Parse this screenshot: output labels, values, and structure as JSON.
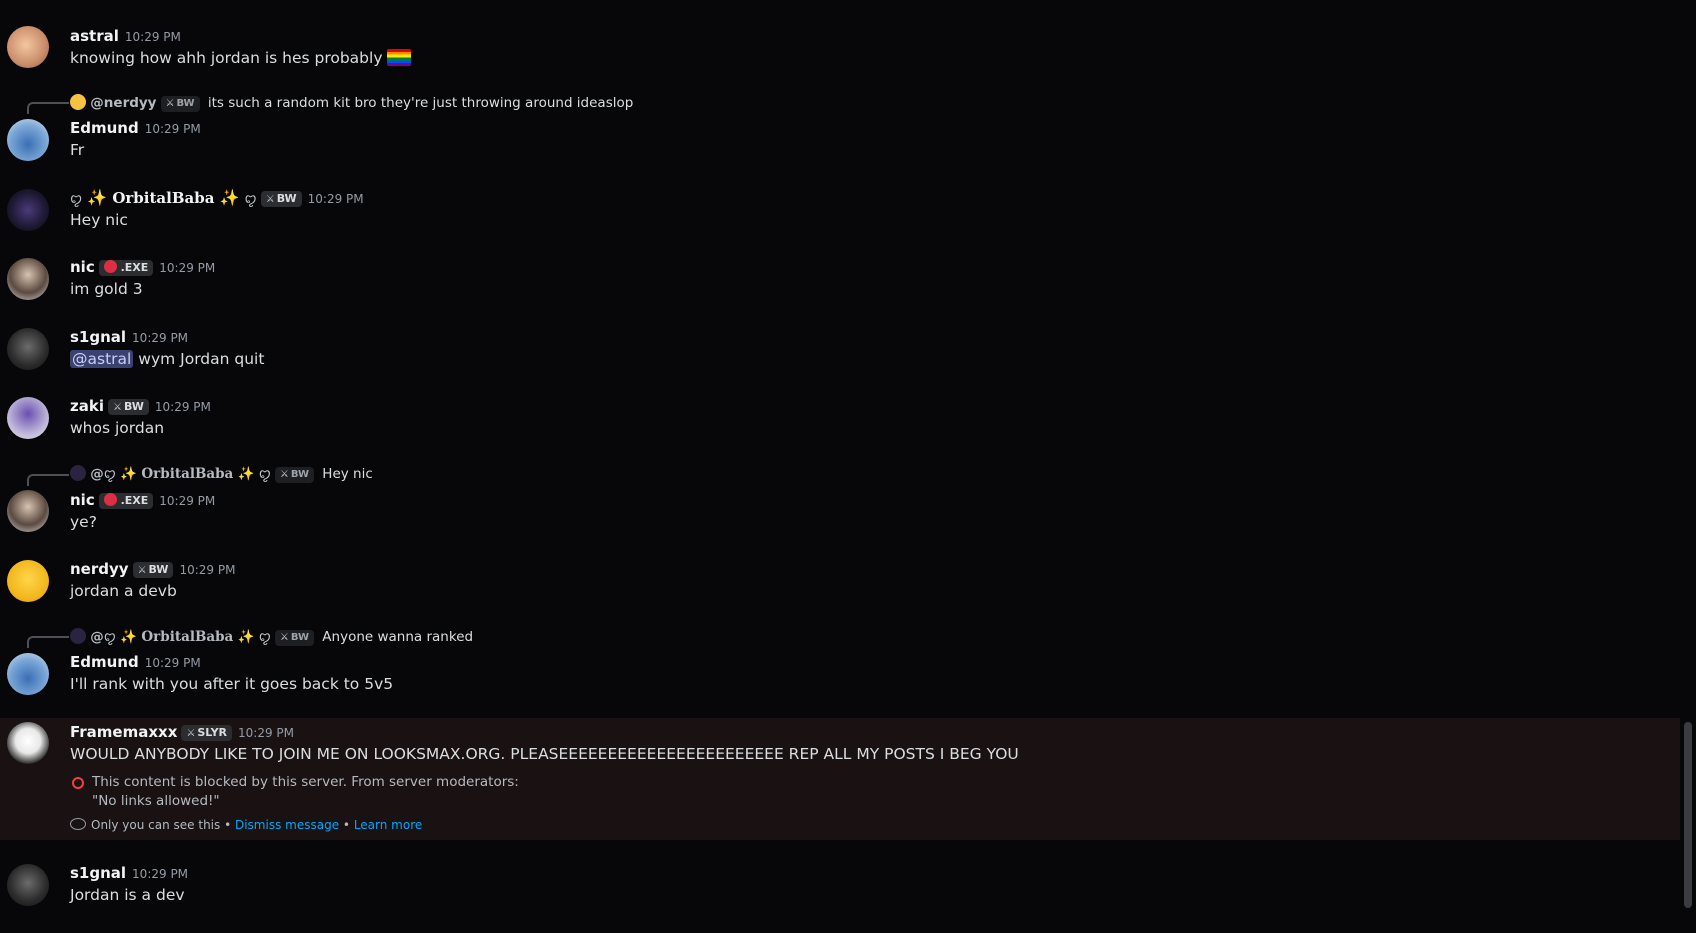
{
  "messages": {
    "m1": {
      "user": "astral",
      "time": "10:29 PM",
      "text": "knowing how ahh jordan is hes probably"
    },
    "m2": {
      "reply_user": "@nerdyy",
      "reply_tag": "BW",
      "reply_text": "its such a random kit bro they're just throwing around ideaslop",
      "user": "Edmund",
      "time": "10:29 PM",
      "text": "Fr"
    },
    "m3": {
      "user": "OrbitalBaba",
      "tag": "BW",
      "time": "10:29 PM",
      "text": "Hey nic"
    },
    "m4": {
      "user": "nic",
      "tag": ".EXE",
      "time": "10:29 PM",
      "text": "im gold 3"
    },
    "m5": {
      "user": "s1gnal",
      "time": "10:29 PM",
      "mention": "@astral",
      "text": "wym Jordan quit"
    },
    "m6": {
      "user": "zaki",
      "tag": "BW",
      "time": "10:29 PM",
      "text": "whos jordan"
    },
    "m7": {
      "reply_at": "@",
      "reply_user": "OrbitalBaba",
      "reply_tag": "BW",
      "reply_text": "Hey nic",
      "user": "nic",
      "tag": ".EXE",
      "time": "10:29 PM",
      "text": "ye?"
    },
    "m8": {
      "user": "nerdyy",
      "tag": "BW",
      "time": "10:29 PM",
      "text": "jordan a devb"
    },
    "m9": {
      "reply_at": "@",
      "reply_user": "OrbitalBaba",
      "reply_tag": "BW",
      "reply_text": "Anyone wanna ranked",
      "user": "Edmund",
      "time": "10:29 PM",
      "text": "I'll rank with you after it goes back to 5v5"
    },
    "m10": {
      "user": "Framemaxxx",
      "tag": "SLYR",
      "time": "10:29 PM",
      "text": "WOULD ANYBODY LIKE TO JOIN ME ON LOOKSMAX.ORG. PLEASEEEEEEEEEEEEEEEEEEEEEEE REP ALL MY POSTS I BEG YOU",
      "blocked_line1": "This content is blocked by this server. From server moderators:",
      "blocked_line2": "\"No links allowed!\"",
      "only_you": "Only you can see this •",
      "dismiss": "Dismiss message",
      "dot": "•",
      "learn": "Learn more"
    },
    "m11": {
      "user": "s1gnal",
      "time": "10:29 PM",
      "text": "Jordan is a dev"
    }
  },
  "colors": {
    "background": "#070709",
    "highlight": "#1a1113",
    "link": "#00a8fc",
    "mention_bg": "#3c4270"
  },
  "icons": [
    "rainbow-flag-icon",
    "sparkle-icon",
    "skull-icon",
    "shield-block-icon",
    "eye-icon",
    "sword-icon"
  ]
}
